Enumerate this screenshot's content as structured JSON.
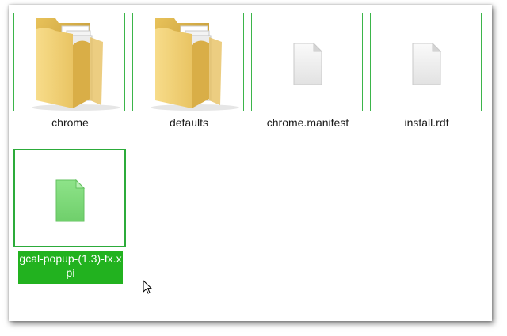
{
  "files": [
    {
      "name": "chrome",
      "icon": "folder-icon",
      "selected": false
    },
    {
      "name": "defaults",
      "icon": "folder-icon",
      "selected": false
    },
    {
      "name": "chrome.manifest",
      "icon": "file-icon",
      "selected": false
    },
    {
      "name": "install.rdf",
      "icon": "file-icon",
      "selected": false
    },
    {
      "name": "gcal-popup-(1.3)-fx.xpi",
      "icon": "xpi-file-icon",
      "selected": true
    }
  ],
  "colors": {
    "thumb_border": "#3bb54a",
    "selection": "#22b21f",
    "folder": "#f3cf6a",
    "xpi_file": "#7ed87a"
  }
}
